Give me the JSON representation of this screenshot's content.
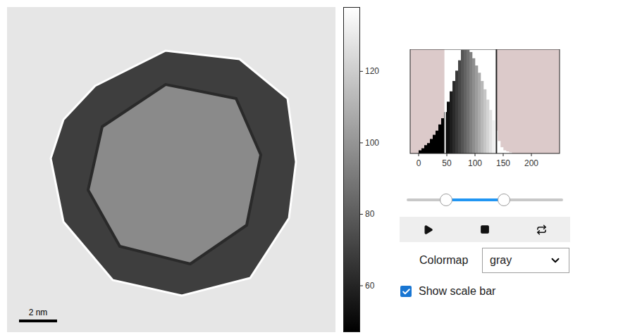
{
  "image": {
    "scale_bar": {
      "visible": true,
      "label": "2 nm"
    }
  },
  "colorbar": {
    "ticks": [
      "120",
      "100",
      "80",
      "60"
    ],
    "min": 47,
    "max": 138
  },
  "histogram": {
    "x_ticks": [
      "0",
      "50",
      "100",
      "150",
      "200"
    ],
    "bin_width": 5,
    "cut_low": 47,
    "cut_high": 138,
    "series": [
      3,
      5,
      8,
      10,
      14,
      18,
      22,
      28,
      34,
      40,
      50,
      60,
      70,
      80,
      90,
      100,
      100,
      100,
      98,
      92,
      85,
      78,
      70,
      62,
      52,
      42,
      32,
      22,
      12,
      6,
      3,
      2,
      1,
      0,
      0,
      0,
      0,
      0,
      0,
      0,
      0,
      0,
      0,
      0,
      0,
      0,
      0
    ]
  },
  "range_slider": {
    "low_level": 0.25,
    "high_level": 0.62
  },
  "controls": {
    "colormap_label": "Colormap",
    "colormap_value": "gray",
    "scale_bar_checkbox": {
      "label": "Show scale bar",
      "checked": true
    }
  }
}
